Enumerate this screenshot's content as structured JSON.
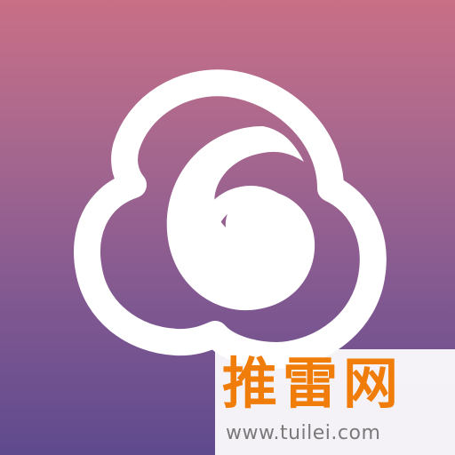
{
  "app_icon": {
    "logo_icon": "cloud-swirl-icon",
    "colors": {
      "gradient_top": "#c96f86",
      "gradient_bottom": "#5f4a8e",
      "logo": "#ffffff"
    }
  },
  "watermark": {
    "brand": "推雷网",
    "url": "www.tuilei.com",
    "colors": {
      "brand": "#f07c0a",
      "url": "#7a7a7a",
      "background": "#ffffff"
    }
  }
}
